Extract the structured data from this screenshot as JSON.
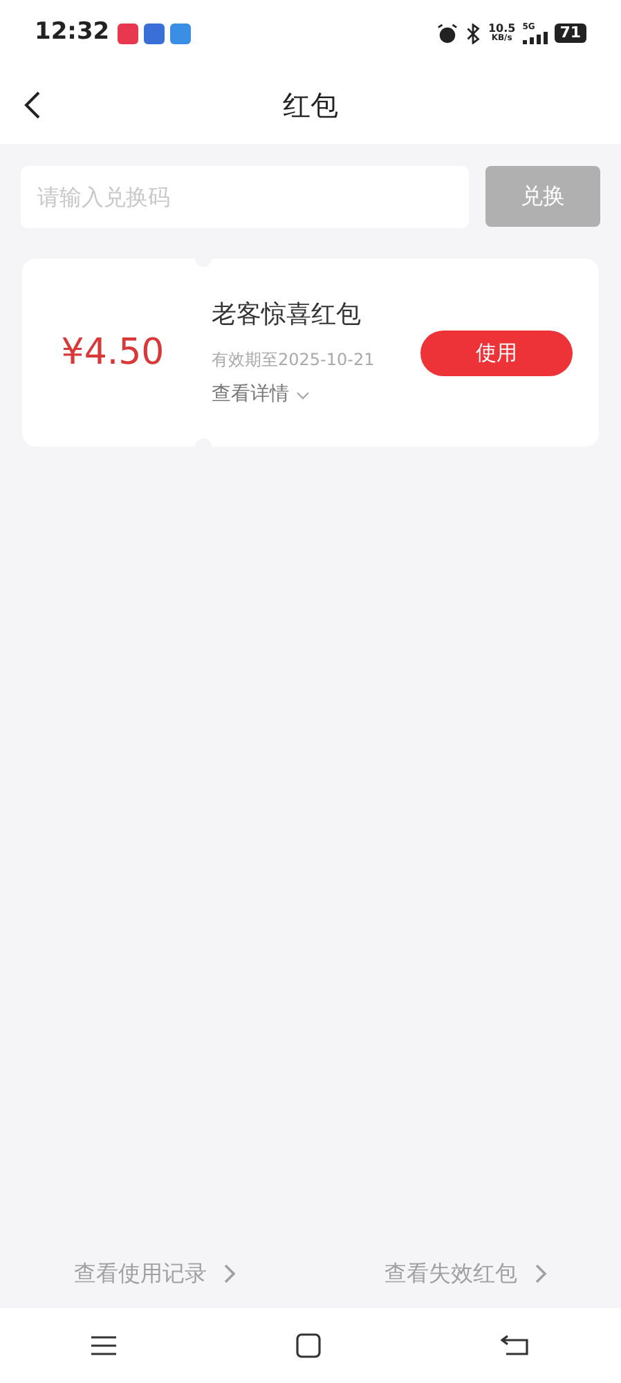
{
  "status_bar": {
    "time": "12:32",
    "speed_value": "10.5",
    "speed_unit": "KB/s",
    "network": "5G",
    "battery": "71"
  },
  "header": {
    "title": "红包"
  },
  "redeem": {
    "placeholder": "请输入兑换码",
    "button": "兑换",
    "disabled": true
  },
  "coupons": [
    {
      "amount": "¥4.50",
      "name": "老客惊喜红包",
      "expiry": "有效期至2025-10-21",
      "details": "查看详情",
      "action": "使用"
    }
  ],
  "footer_links": [
    "查看使用记录",
    "查看失效红包"
  ]
}
